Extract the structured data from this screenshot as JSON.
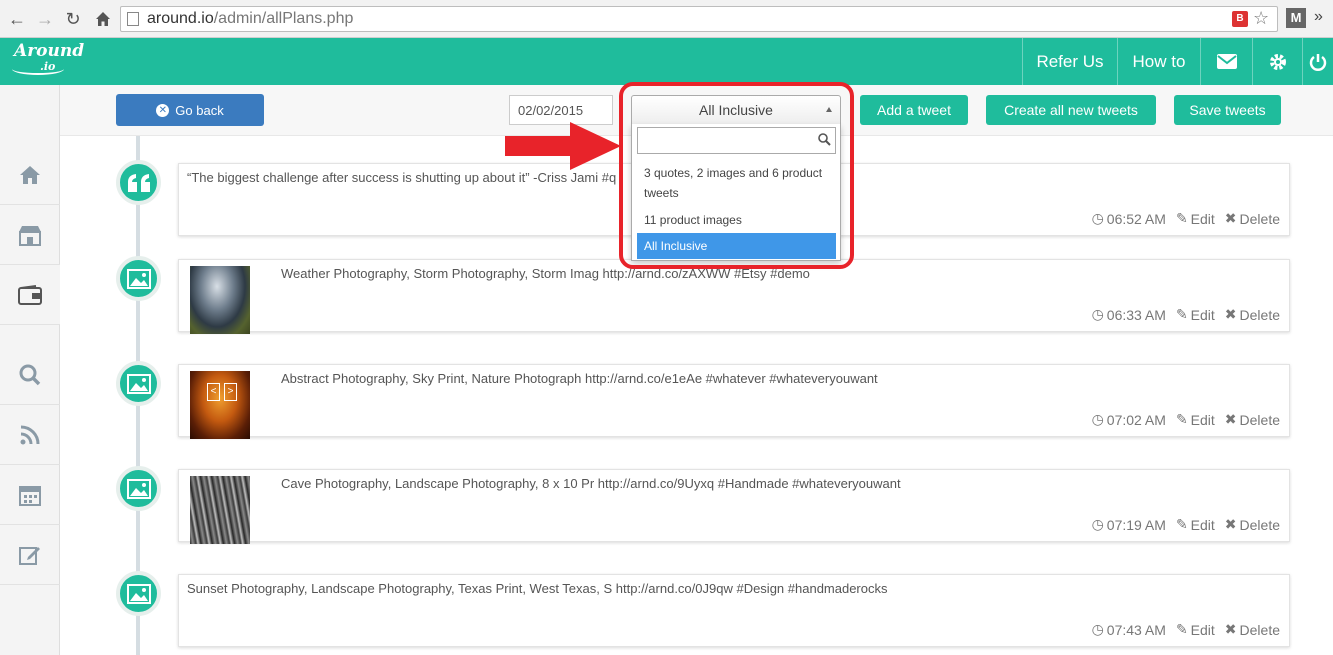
{
  "browser": {
    "url_domain": "around.io",
    "url_path": "/admin/allPlans.php"
  },
  "header": {
    "logo_main": "Around",
    "logo_sub": ".io",
    "refer_label": "Refer Us",
    "howto_label": "How to"
  },
  "toolbar": {
    "go_back_label": "Go back",
    "date_value": "02/02/2015",
    "plan_selected": "All Inclusive",
    "add_tweet_label": "Add a tweet",
    "create_all_label": "Create all new tweets",
    "save_label": "Save tweets"
  },
  "dropdown": {
    "search_value": "",
    "options": [
      {
        "label": "3 quotes, 2 images and 6 product tweets",
        "selected": false
      },
      {
        "label": "11 product images",
        "selected": false
      },
      {
        "label": "All Inclusive",
        "selected": true
      }
    ]
  },
  "tweets": [
    {
      "type": "quote",
      "text": "“The biggest challenge after success is shutting up about it” -Criss Jami #q",
      "time": "06:52 AM",
      "edit": "Edit",
      "delete": "Delete"
    },
    {
      "type": "image",
      "text": "Weather Photography, Storm Photography, Storm Imag http://arnd.co/zAXWW #Etsy #demo",
      "time": "06:33 AM",
      "edit": "Edit",
      "delete": "Delete"
    },
    {
      "type": "image",
      "text": "Abstract Photography, Sky Print, Nature Photograph http://arnd.co/e1eAe #whatever #whateveryouwant",
      "time": "07:02 AM",
      "edit": "Edit",
      "delete": "Delete"
    },
    {
      "type": "image",
      "text": "Cave Photography, Landscape Photography, 8 x 10 Pr http://arnd.co/9Uyxq #Handmade #whateveryouwant",
      "time": "07:19 AM",
      "edit": "Edit",
      "delete": "Delete"
    },
    {
      "type": "image",
      "text": "Sunset Photography, Landscape Photography, Texas Print, West Texas, S http://arnd.co/0J9qw #Design #handmaderocks",
      "time": "07:43 AM",
      "edit": "Edit",
      "delete": "Delete"
    }
  ],
  "sidebar": {
    "items": [
      "home-icon",
      "store-icon",
      "wallet-icon",
      "search-icon",
      "rss-icon",
      "calendar-icon",
      "edit-icon"
    ]
  },
  "colors": {
    "brand": "#1fbc9c",
    "go_back": "#3b7bbf",
    "selected_option": "#3f97e8",
    "highlight": "#e8232a"
  }
}
